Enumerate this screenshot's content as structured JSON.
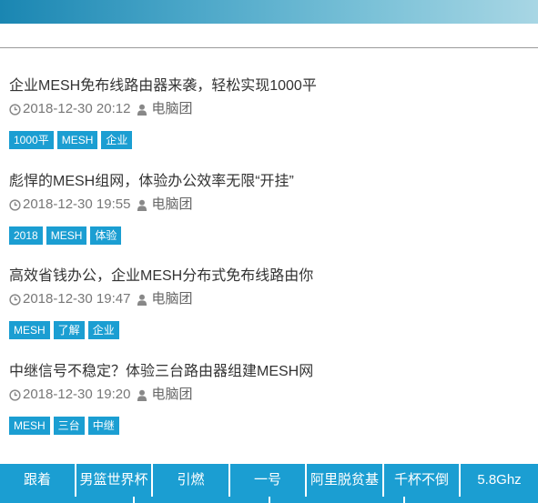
{
  "articles": [
    {
      "title": "企业MESH免布线路由器来袭，轻松实现1000平",
      "date": "2018-12-30 20:12",
      "author": "电脑团",
      "tags": [
        "1000平",
        "MESH",
        "企业"
      ]
    },
    {
      "title": "彪悍的MESH组网，体验办公效率无限“开挂”",
      "date": "2018-12-30 19:55",
      "author": "电脑团",
      "tags": [
        "2018",
        "MESH",
        "体验"
      ]
    },
    {
      "title": "高效省钱办公，企业MESH分布式免布线路由你",
      "date": "2018-12-30 19:47",
      "author": "电脑团",
      "tags": [
        "MESH",
        "了解",
        "企业"
      ]
    },
    {
      "title": "中继信号不稳定？体验三台路由器组建MESH网",
      "date": "2018-12-30 19:20",
      "author": "电脑团",
      "tags": [
        "MESH",
        "三台",
        "中继"
      ]
    }
  ],
  "hot_keywords": [
    "跟着",
    "男篮世界杯",
    "引燃",
    "一号",
    "阿里脱贫基",
    "千杯不倒",
    "5.8Ghz"
  ],
  "colors": {
    "accent": "#1b9ed2",
    "meta_text": "#777777",
    "title_text": "#333333"
  },
  "icons": {
    "date": "clock-icon",
    "author": "user-icon"
  }
}
